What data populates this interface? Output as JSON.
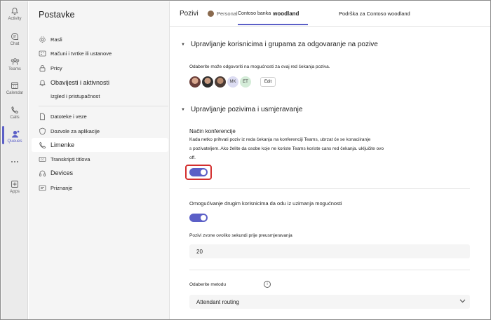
{
  "rail": {
    "items": [
      {
        "label": "Activity",
        "icon": "bell-icon"
      },
      {
        "label": "Chat",
        "icon": "chat-icon"
      },
      {
        "label": "Teams",
        "icon": "teams-icon"
      },
      {
        "label": "Calendar",
        "icon": "calendar-icon"
      },
      {
        "label": "Calls",
        "icon": "phone-icon"
      },
      {
        "label": "Queues",
        "icon": "queues-icon"
      },
      {
        "label": "",
        "icon": "more-icon"
      },
      {
        "label": "Apps",
        "icon": "apps-icon"
      }
    ]
  },
  "nav": {
    "title": "Postavke",
    "items": [
      {
        "label": "Rasli",
        "icon": "gear-icon"
      },
      {
        "label": "Računi i tvrtke ili ustanove",
        "icon": "org-icon"
      },
      {
        "label": "Pricy",
        "icon": "lock-icon"
      },
      {
        "label": "Obavijesti i aktivnosti",
        "icon": "bell-icon"
      },
      {
        "label": "Izgled i pristupačnost",
        "icon": "eye-icon"
      },
      {
        "label": "Datoteke i veze",
        "icon": "file-icon"
      },
      {
        "label": "Dozvole za aplikacije",
        "icon": "shield-icon"
      },
      {
        "label": "Limenke",
        "icon": "phone-icon"
      },
      {
        "label": "Transkripti titlova",
        "icon": "cc-icon"
      },
      {
        "label": "Devices",
        "icon": "headset-icon"
      },
      {
        "label": "Priznanje",
        "icon": "recognition-icon"
      }
    ]
  },
  "tabs": {
    "title": "Pozivi",
    "personal": "Personal",
    "contoso": "Contoso banka",
    "contoso_bold": "woodland",
    "support": "Podrška za Contoso woodland"
  },
  "section1": {
    "title": "Upravljanje korisnicima i grupama za odgovaranje na pozive",
    "desc": "Odaberite može odgovoriti na mogućnosti za ovaj red čekanja poziva.",
    "avatars": [
      "MK",
      "ET"
    ],
    "edit": "Edit"
  },
  "section2": {
    "title": "Upravljanje pozivima i usmjeravanje",
    "conf_title": "Način konferencije",
    "conf_desc1": "Kada netko prihvati poziv iz reda čekanja na konferenciji Teams, ubrzat će se konaciiranje",
    "conf_desc2": "s pozivateljem. Ako želite da osobe koje ne koriste Teams koriste cans red čekanja. uključite ovo",
    "conf_desc3": "off.",
    "conf_toggle": "on",
    "optout_title": "Omogućivanje drugim korisnicima da odu iz uzimanja mogućnosti",
    "optout_toggle": "on",
    "ring_label": "Pozivi zvone ovoliko sekundi prije preusmjeravanja",
    "ring_value": "20",
    "method_label": "Odaberite metodu",
    "method_value": "Attendant routing"
  },
  "colors": {
    "accent": "#5b5fc7",
    "highlight": "#d32f2f"
  }
}
